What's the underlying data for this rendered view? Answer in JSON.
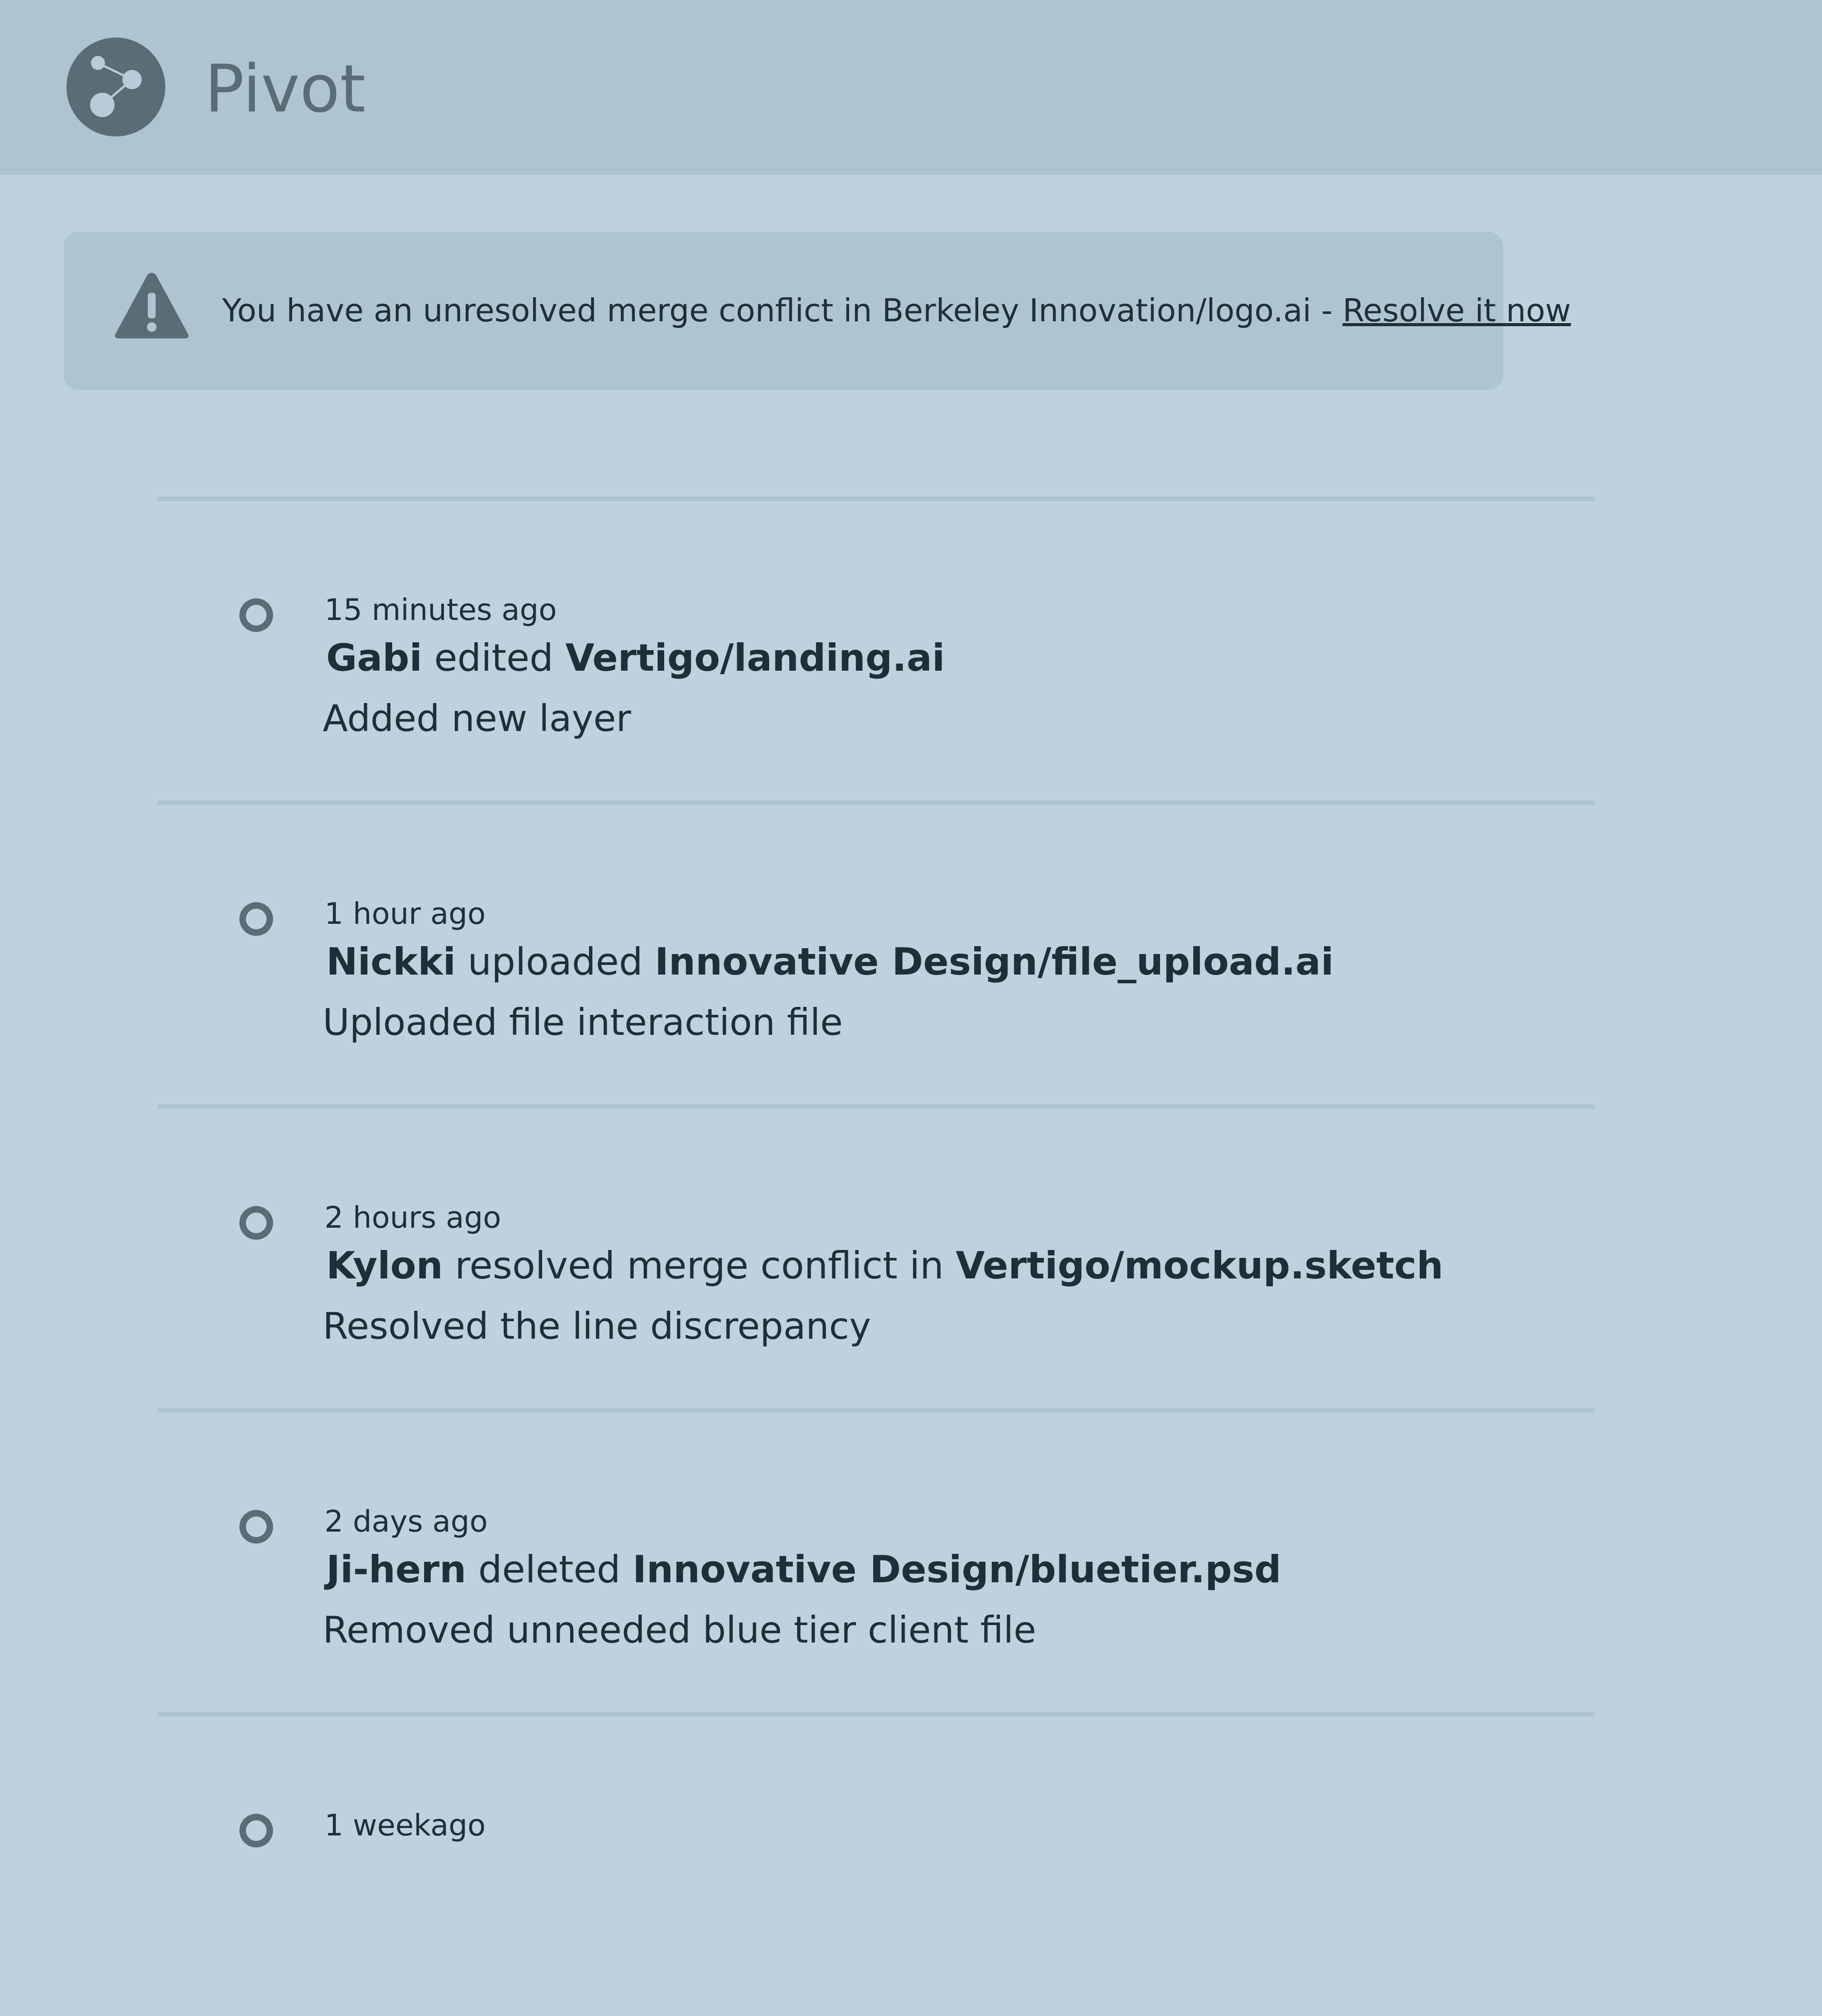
{
  "app": {
    "title": "Pivot",
    "logo_icon": "share-nodes-icon"
  },
  "alert": {
    "icon": "warning-icon",
    "message": "You have an unresolved merge conflict in Berkeley Innovation/logo.ai",
    "separator": " - ",
    "link_label": "Resolve it now"
  },
  "colors": {
    "background": "#bed1de",
    "header": "#afc4d1",
    "icon": "#5a6c75",
    "text": "#1e2f37"
  },
  "activity": [
    {
      "time": "15 minutes ago",
      "user": "Gabi",
      "verb": "edited",
      "target": "Vertigo/landing.ai",
      "message": "Added new layer"
    },
    {
      "time": "1 hour ago",
      "user": "Nickki",
      "verb": "uploaded",
      "target": "Innovative Design/file_upload.ai",
      "message": "Uploaded file interaction file"
    },
    {
      "time": "2 hours ago",
      "user": "Kylon",
      "verb": "resolved merge conflict in",
      "target": "Vertigo/mockup.sketch",
      "message": "Resolved the line discrepancy"
    },
    {
      "time": "2 days ago",
      "user": "Ji-hern",
      "verb": "deleted",
      "target": "Innovative Design/bluetier.psd",
      "message": "Removed unneeded blue tier client file"
    },
    {
      "time": "1 weekago",
      "user": "",
      "verb": "",
      "target": "",
      "message": ""
    }
  ]
}
